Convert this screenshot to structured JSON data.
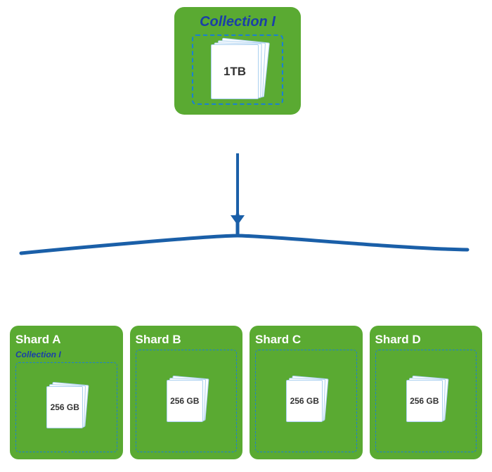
{
  "top_collection": {
    "title": "Collection I",
    "size": "1TB"
  },
  "shards": [
    {
      "id": "shard-a",
      "title": "Shard A",
      "collection_label": "Collection I",
      "size": "256 GB"
    },
    {
      "id": "shard-b",
      "title": "Shard B",
      "collection_label": "",
      "size": "256 GB"
    },
    {
      "id": "shard-c",
      "title": "Shard C",
      "collection_label": "",
      "size": "256 GB"
    },
    {
      "id": "shard-d",
      "title": "Shard D",
      "collection_label": "",
      "size": "256 GB"
    }
  ],
  "colors": {
    "green": "#5aaa32",
    "blue_title": "#1a3fa8",
    "blue_arrow": "#1a5fa8",
    "blue_dashed": "#1a7fd4",
    "white": "#ffffff"
  }
}
